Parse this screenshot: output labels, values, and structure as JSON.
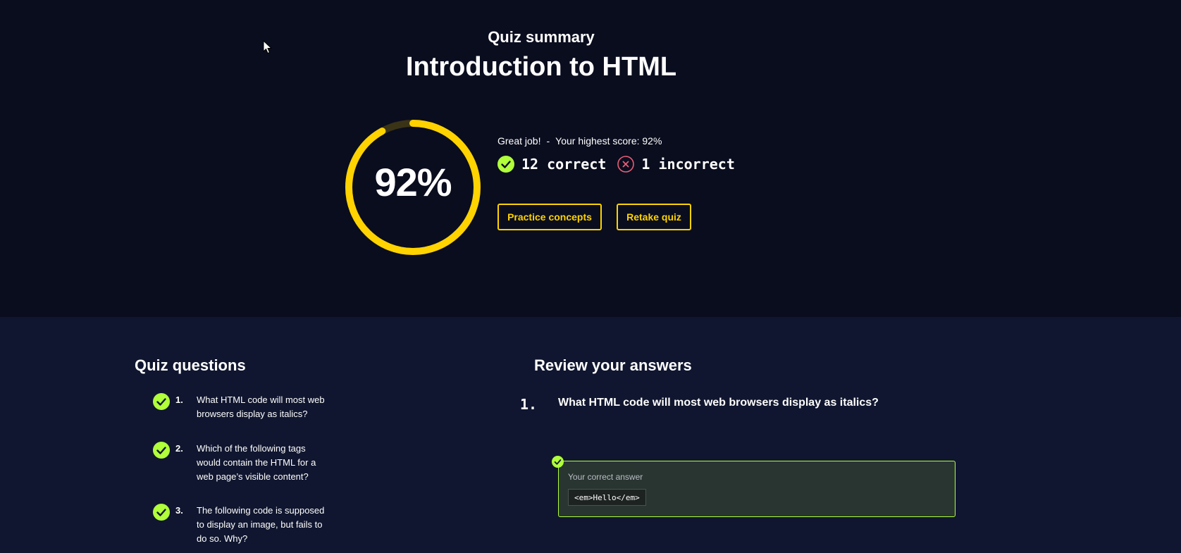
{
  "header": {
    "eyebrow": "Quiz summary",
    "title": "Introduction to HTML"
  },
  "score": {
    "percent_text": "92%",
    "percent_value": 92,
    "message": "Great job!",
    "separator": "-",
    "highest_score": "Your highest score: 92%",
    "correct_text": "12 correct",
    "incorrect_text": "1 incorrect"
  },
  "actions": {
    "practice_label": "Practice concepts",
    "retake_label": "Retake quiz"
  },
  "quiz_questions": {
    "title": "Quiz questions",
    "items": [
      {
        "number": "1.",
        "text": "What HTML code will most web browsers display as italics?",
        "status": "correct"
      },
      {
        "number": "2.",
        "text": "Which of the following tags would contain the HTML for a web page’s visible content?",
        "status": "correct"
      },
      {
        "number": "3.",
        "text": "The following code is supposed to display an image, but fails to do so. Why?",
        "status": "correct"
      }
    ]
  },
  "review": {
    "title": "Review your answers",
    "question_number": "1.",
    "question_text": "What HTML code will most web browsers display as italics?",
    "answer_label": "Your correct answer",
    "answer_code": "<em>Hello</em>"
  },
  "colors": {
    "accent_yellow": "#ffd300",
    "correct_green": "#b0ff3a",
    "incorrect_red": "#e85d75",
    "top_bg": "#0a0d1e",
    "bottom_bg": "#10162f"
  }
}
